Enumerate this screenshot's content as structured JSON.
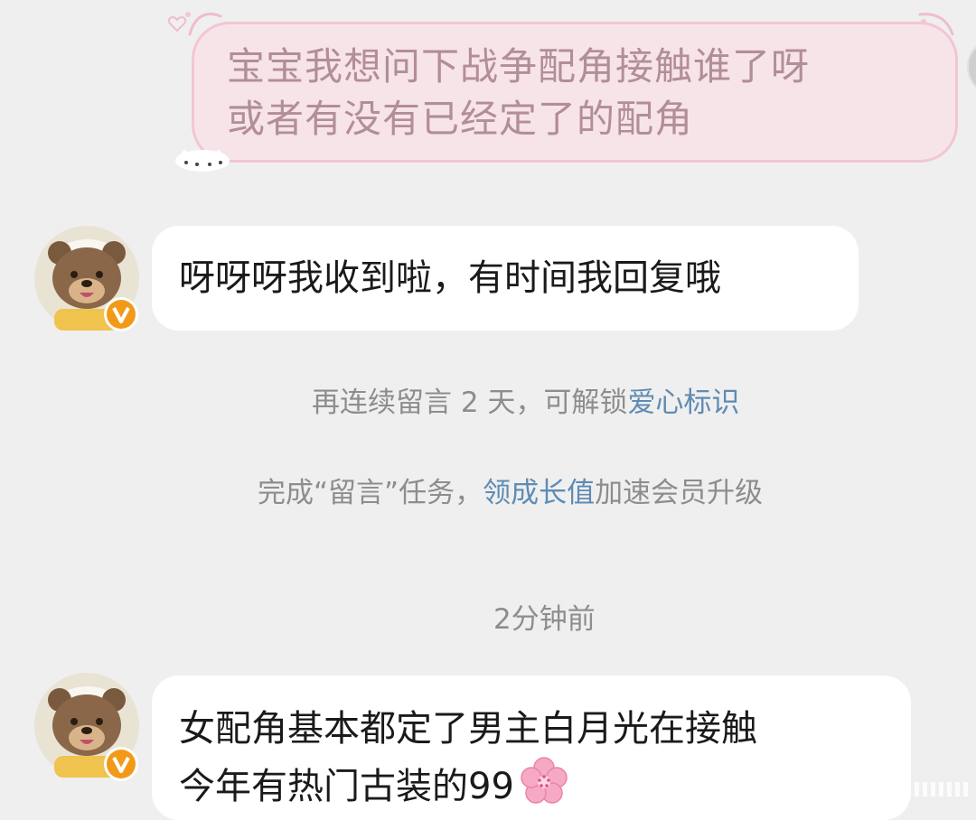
{
  "outgoing_message": {
    "line1": "宝宝我想问下战争配角接触谁了呀",
    "line2": "或者有没有已经定了的配角"
  },
  "incoming_messages": [
    {
      "lines": [
        "呀呀呀我收到啦，有时间我回复哦"
      ]
    },
    {
      "lines": [
        "女配角基本都定了男主白月光在接触",
        "今年有热门古装的99"
      ]
    }
  ],
  "notices": {
    "streak": {
      "prefix": "再连续留言 2 天，可解锁",
      "highlight": "爱心标识"
    },
    "task": {
      "prefix": "完成“留言”任务，",
      "highlight": "领成长值",
      "suffix": "加速会员升级"
    }
  },
  "timestamp": "2分钟前",
  "icons": {
    "avatar": "bear-avatar-icon",
    "verified_badge": "verified-v-badge-icon",
    "emoji": "cherry-blossom-icon"
  },
  "colors": {
    "background": "#efefef",
    "outgoing_bubble": "#f7e4e8",
    "outgoing_text": "#b28e97",
    "incoming_bubble": "#ffffff",
    "notice_text": "#8d8d8d",
    "notice_highlight": "#5e8cb3",
    "verified_badge": "#f29a18"
  }
}
